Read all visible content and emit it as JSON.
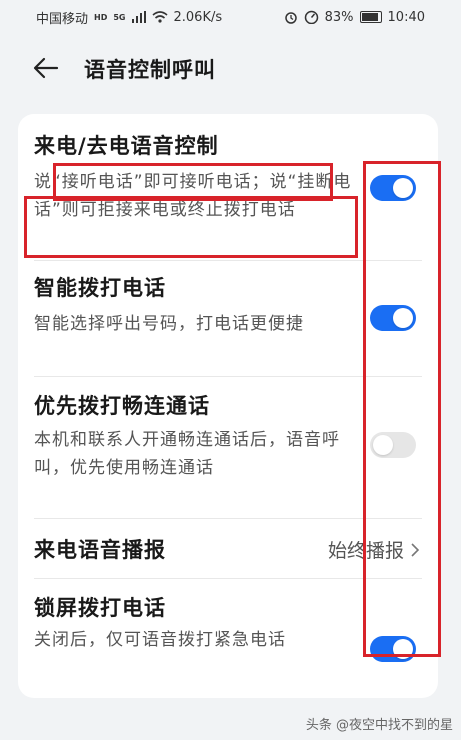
{
  "status_bar": {
    "carrier": "中国移动",
    "hd": "HD",
    "signal": "5G",
    "speed": "2.06K/s",
    "battery_pct": "83%",
    "time": "10:40"
  },
  "header": {
    "title": "语音控制呼叫"
  },
  "settings": [
    {
      "title": "来电/去电语音控制",
      "desc": "说“接听电话”即可接听电话；说“挂断电话”则可拒接来电或终止拨打电话",
      "enabled": true
    },
    {
      "title": "智能拨打电话",
      "desc": "智能选择呼出号码，打电话更便捷",
      "enabled": true
    },
    {
      "title": "优先拨打畅连通话",
      "desc": "本机和联系人开通畅连通话后，语音呼叫，优先使用畅连通话",
      "enabled": false
    },
    {
      "title": "来电语音播报",
      "value": "始终播报"
    },
    {
      "title": "锁屏拨打电话",
      "desc": "关闭后，仅可语音拨打紧急电话",
      "enabled": true
    }
  ],
  "colors": {
    "accent": "#1a6ef3",
    "annotation": "#d8232a",
    "toggle_off": "#e6e6e6"
  },
  "watermark": "头条 @夜空中找不到的星"
}
